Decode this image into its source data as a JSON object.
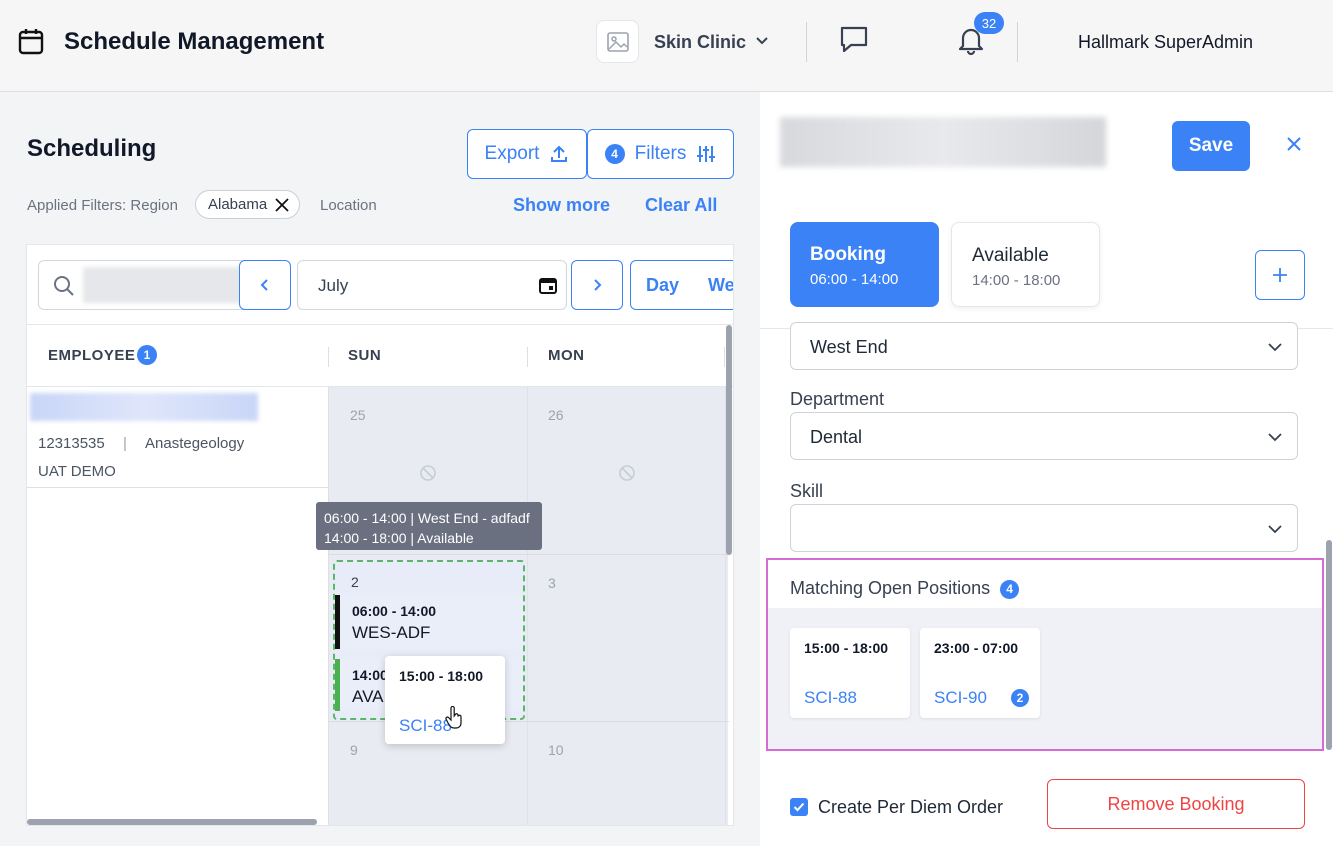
{
  "header": {
    "title": "Schedule Management",
    "clinic_name": "Skin Clinic",
    "notification_count": "32",
    "user_name": "Hallmark SuperAdmin"
  },
  "scheduling": {
    "title": "Scheduling",
    "export_label": "Export",
    "filters_count": "4",
    "filters_label": "Filters",
    "applied_filters_label": "Applied Filters:",
    "region_label": "Region",
    "region_chip": "Alabama",
    "location_label": "Location",
    "show_more": "Show more",
    "clear_all": "Clear All"
  },
  "calendar": {
    "month": "July",
    "view_day": "Day",
    "view_week": "We",
    "columns": {
      "employee": "EMPLOYEE",
      "employee_count": "1",
      "sun": "SUN",
      "mon": "MON"
    },
    "employee": {
      "id": "12313535",
      "separator": "|",
      "department": "Anastegeology",
      "org": "UAT DEMO"
    },
    "days": {
      "d25": "25",
      "d26": "26",
      "d2": "2",
      "d3": "3",
      "d9": "9",
      "d10": "10"
    },
    "tooltip": {
      "line1": "06:00 - 14:00 | West End - adfadf",
      "line2": "14:00 - 18:00 | Available"
    },
    "shifts": [
      {
        "time": "06:00 - 14:00",
        "code": "WES-ADF"
      },
      {
        "time": "14:00",
        "code": "AVA"
      }
    ],
    "popup": {
      "time": "15:00 - 18:00",
      "code": "SCI-88"
    }
  },
  "detail_panel": {
    "save_label": "Save",
    "tabs": [
      {
        "title": "Booking",
        "time": "06:00 - 14:00"
      },
      {
        "title": "Available",
        "time": "14:00 - 18:00"
      }
    ],
    "location_value": "West End",
    "department_label": "Department",
    "department_value": "Dental",
    "skill_label": "Skill",
    "skill_value": "",
    "matching": {
      "title": "Matching Open Positions",
      "count": "4",
      "positions": [
        {
          "time": "15:00 - 18:00",
          "code": "SCI-88"
        },
        {
          "time": "23:00 - 07:00",
          "code": "SCI-90",
          "count": "2"
        }
      ]
    },
    "per_diem_label": "Create Per Diem Order",
    "remove_label": "Remove Booking"
  },
  "colors": {
    "accent": "#3b82f6",
    "danger": "#ef4444",
    "highlight_border": "#d66bd2",
    "available_bar": "#4caf50"
  }
}
